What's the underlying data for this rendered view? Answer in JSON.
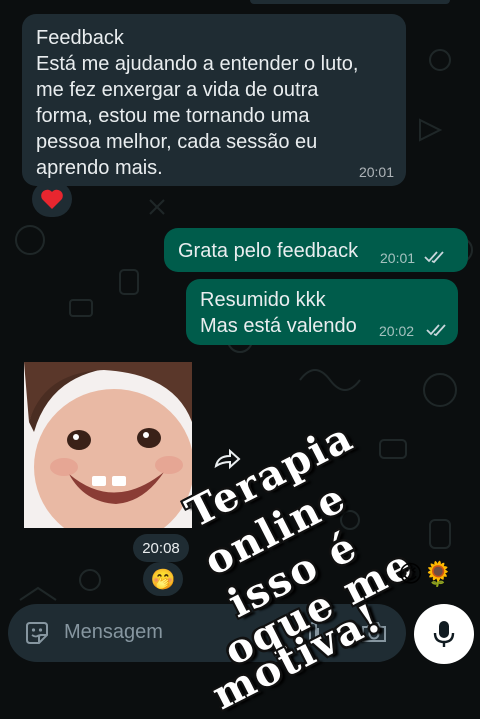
{
  "chat": {
    "incoming_feedback": {
      "title": "Feedback",
      "lines": [
        "Está me ajudando a entender o luto,",
        "me fez enxergar a vida de outra",
        "forma, estou me tornando uma",
        "pessoa  melhor, cada sessão eu",
        "aprendo mais."
      ],
      "time": "20:01",
      "reaction": "❤️"
    },
    "outgoing_1": {
      "text": "Grata pelo feedback",
      "time": "20:01"
    },
    "outgoing_2": {
      "lines": [
        "Resumido kkk",
        "Mas está valendo"
      ],
      "time": "20:02"
    },
    "sticker": {
      "time": "20:08",
      "reaction": "🤭"
    }
  },
  "overlay": {
    "lines": [
      "Terapia",
      "online",
      "isso é",
      "oque me",
      "motiva!"
    ],
    "emojis": "😉🌻"
  },
  "composer": {
    "placeholder": "Mensagem"
  },
  "colors": {
    "background": "#0b0e0f",
    "incoming_bubble": "#1f2c33",
    "outgoing_bubble": "#005c4b",
    "mic_button": "#ffffff"
  },
  "icons": [
    "heart-icon",
    "double-check-icon",
    "forward-icon",
    "sticker-icon",
    "paperclip-icon",
    "camera-icon",
    "mic-icon"
  ]
}
